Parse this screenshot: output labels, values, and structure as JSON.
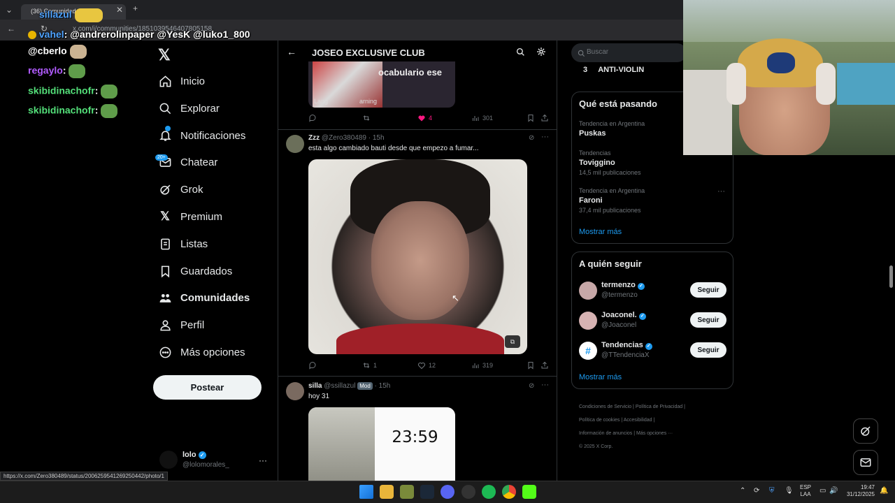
{
  "browser": {
    "tab_title": "(36) Comunidad",
    "url": "x.com/i/communities/1851039546407805158",
    "status_url": "https://x.com/Zero380489/status/2006259541269250442/photo/1"
  },
  "stream_chat": [
    {
      "user": "sillazul",
      "text": "",
      "color": "#4fa3ff"
    },
    {
      "user": "vahel",
      "text": ": @andrerolinpaper @YesK @luko1_800",
      "color": "#4fa3ff"
    },
    {
      "user": "@cberlo",
      "text": "",
      "color": "#ffffff"
    },
    {
      "user": "regaylo",
      "text": ":",
      "color": "#b15cff"
    },
    {
      "user": "skibidinachofr",
      "text": ":",
      "color": "#54e07a"
    },
    {
      "user": "skibidinachofr",
      "text": ":",
      "color": "#54e07a"
    }
  ],
  "nav": {
    "items": [
      {
        "label": "Inicio",
        "icon": "home-icon"
      },
      {
        "label": "Explorar",
        "icon": "search-icon"
      },
      {
        "label": "Notificaciones",
        "icon": "bell-icon"
      },
      {
        "label": "Chatear",
        "icon": "mail-icon"
      },
      {
        "label": "Grok",
        "icon": "grok-icon"
      },
      {
        "label": "Premium",
        "icon": "x-logo-icon"
      },
      {
        "label": "Listas",
        "icon": "list-icon"
      },
      {
        "label": "Guardados",
        "icon": "bookmark-icon"
      },
      {
        "label": "Comunidades",
        "icon": "communities-icon"
      },
      {
        "label": "Perfil",
        "icon": "person-icon"
      },
      {
        "label": "Más opciones",
        "icon": "more-circle-icon"
      }
    ],
    "chat_badge": "20+",
    "post_label": "Postear",
    "account": {
      "name": "lolo",
      "handle": "@lolomorales_"
    }
  },
  "feed": {
    "title": "JOSEO EXCLUSIVE CLUB",
    "top_post": {
      "image_text": "ocabulario ese",
      "image_caption": "Lang",
      "image_caption2": "arning",
      "likes": "4",
      "views": "301"
    },
    "post1": {
      "name": "Zzz",
      "handle": "@Zero380489",
      "time": "· 15h",
      "text": "esta algo cambiado bauti desde que empezo a fumar...",
      "reposts": "1",
      "likes": "12",
      "views": "319"
    },
    "post2": {
      "name": "silla",
      "handle": "@ssillazul",
      "badge": "Mod",
      "time": "· 15h",
      "text": "hoy 31",
      "clock": "23:59"
    }
  },
  "right": {
    "search_placeholder": "Buscar",
    "rank_item": {
      "num": "3",
      "label": "ANTI-VIOLIN"
    },
    "trends_title": "Qué está pasando",
    "trends": [
      {
        "context": "Tendencia en Argentina",
        "name": "Puskas",
        "count": ""
      },
      {
        "context": "Tendencias",
        "name": "Toviggino",
        "count": "14,5 mil publicaciones"
      },
      {
        "context": "Tendencia en Argentina",
        "name": "Faroni",
        "count": "37,4 mil publicaciones"
      }
    ],
    "show_more": "Mostrar más",
    "follow_title": "A quién seguir",
    "follow": [
      {
        "name": "termenzo",
        "handle": "@termenzo",
        "avatar_color": "#c7a8a8"
      },
      {
        "name": "Joaconel.",
        "handle": "@Joaconel",
        "avatar_color": "#d6b2b2"
      },
      {
        "name": "Tendencias",
        "handle": "@TTendenciaX",
        "avatar_color": "#1d9bf0"
      }
    ],
    "follow_label": "Seguir",
    "footer": [
      "Condiciones de Servicio",
      "Política de Privacidad",
      "Política de cookies",
      "Accesibilidad",
      "Información de anuncios",
      "Más opciones ···",
      "© 2025 X Corp."
    ]
  },
  "taskbar": {
    "lang": "ESP",
    "lang2": "LAA",
    "time": "19:47",
    "date": "31/12/2025"
  }
}
